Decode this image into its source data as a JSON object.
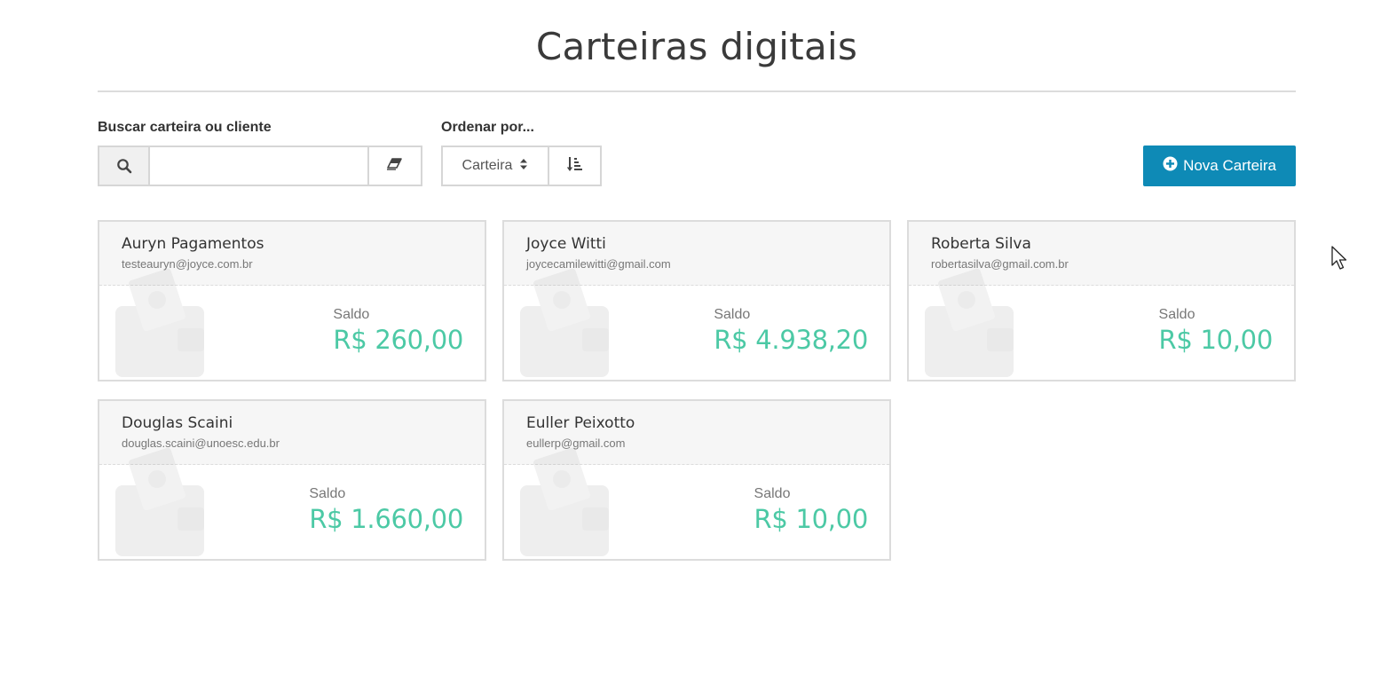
{
  "page": {
    "title": "Carteiras digitais"
  },
  "search": {
    "label": "Buscar carteira ou cliente",
    "value": "",
    "placeholder": ""
  },
  "order": {
    "label": "Ordenar por...",
    "selected": "Carteira"
  },
  "toolbar": {
    "new_wallet_label": "Nova Carteira"
  },
  "wallets": [
    {
      "name": "Auryn Pagamentos",
      "email": "testeauryn@joyce.com.br",
      "balance_label": "Saldo",
      "balance": "R$ 260,00"
    },
    {
      "name": "Joyce Witti",
      "email": "joycecamilewitti@gmail.com",
      "balance_label": "Saldo",
      "balance": "R$ 4.938,20"
    },
    {
      "name": "Roberta Silva",
      "email": "robertasilva@gmail.com.br",
      "balance_label": "Saldo",
      "balance": "R$ 10,00"
    },
    {
      "name": "Douglas Scaini",
      "email": "douglas.scaini@unoesc.edu.br",
      "balance_label": "Saldo",
      "balance": "R$ 1.660,00"
    },
    {
      "name": "Euller Peixotto",
      "email": "eullerp@gmail.com",
      "balance_label": "Saldo",
      "balance": "R$ 10,00"
    }
  ],
  "colors": {
    "accent": "#0e8ab6",
    "balance": "#4cc9a5"
  }
}
